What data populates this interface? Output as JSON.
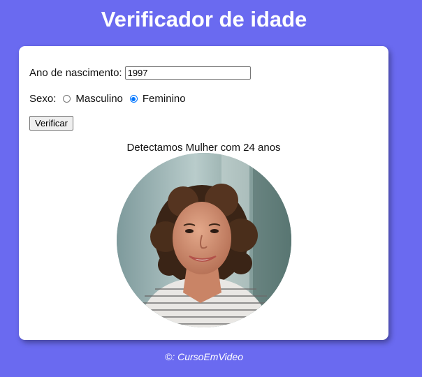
{
  "header": {
    "title": "Verificador de idade"
  },
  "form": {
    "year_label": "Ano de nascimento:",
    "year_value": "1997",
    "sex_label": "Sexo:",
    "options": [
      {
        "label": "Masculino",
        "checked": false
      },
      {
        "label": "Feminino",
        "checked": true
      }
    ],
    "button_label": "Verificar"
  },
  "result": {
    "text": "Detectamos Mulher com 24 anos",
    "photo_icon": "woman-portrait"
  },
  "footer": {
    "text": "©: CursoEmVideo"
  },
  "colors": {
    "background": "#6a6af0",
    "card": "#ffffff",
    "radio_accent": "#0075ff"
  }
}
